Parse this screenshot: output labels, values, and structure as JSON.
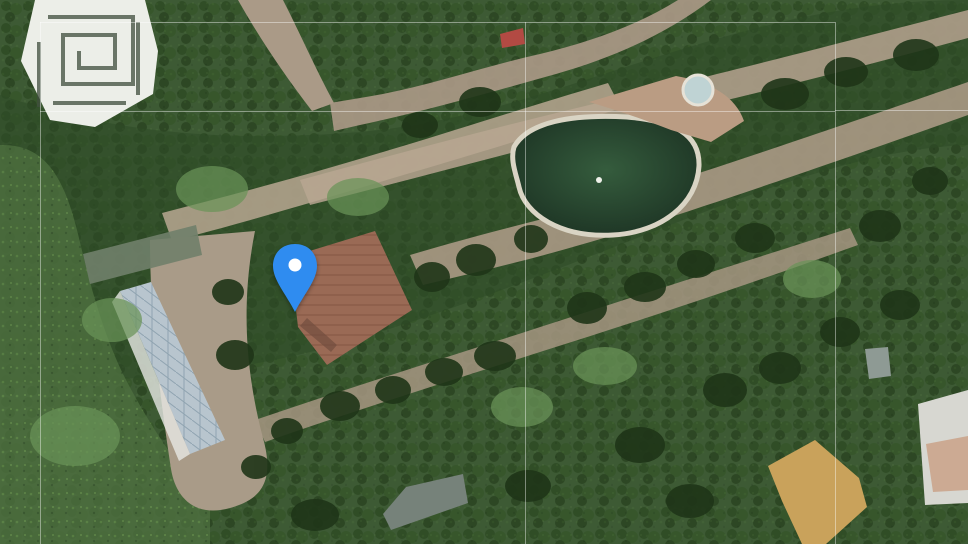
{
  "map": {
    "view": "satellite",
    "marker": {
      "icon": "location-pin-icon",
      "color": "#2F8CF0",
      "inner_color": "#FFFFFF"
    },
    "grid_color": "#FFFFFF",
    "colors": {
      "grass": "#3f5a35",
      "grass_light": "#587b44",
      "trees": "#253f1c",
      "paths": "#a89580",
      "pond": "#27452f",
      "roof": "#94624e",
      "greenhouse": "#b7c2ca",
      "yellow_roof": "#c9a457"
    }
  }
}
